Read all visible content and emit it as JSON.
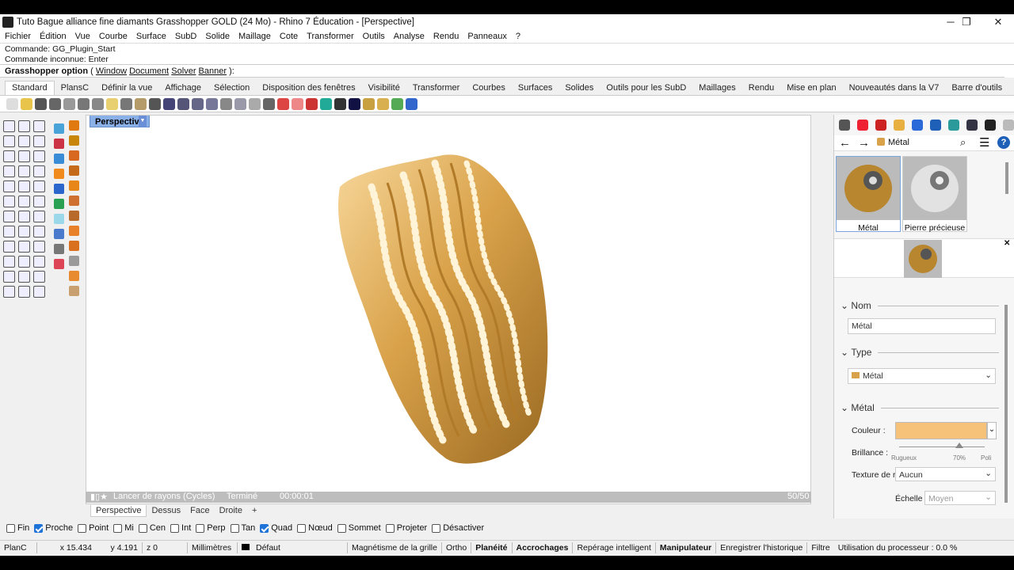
{
  "window": {
    "title": "Tuto Bague alliance fine diamants Grasshopper GOLD (24 Mo) - Rhino 7 Éducation - [Perspective]",
    "min": "─",
    "restore": "❐",
    "close": "✕"
  },
  "menu": [
    "Fichier",
    "Édition",
    "Vue",
    "Courbe",
    "Surface",
    "SubD",
    "Solide",
    "Maillage",
    "Cote",
    "Transformer",
    "Outils",
    "Analyse",
    "Rendu",
    "Panneaux",
    "?"
  ],
  "command": {
    "history": [
      "Commande: GG_Plugin_Start",
      "Commande inconnue: Enter"
    ],
    "prompt_label": "Grasshopper option",
    "options_open": " ( ",
    "options": [
      "Window",
      "Document",
      "Solver",
      "Banner"
    ],
    "options_close": " ):"
  },
  "tabs": [
    "Standard",
    "PlansC",
    "Définir la vue",
    "Affichage",
    "Sélection",
    "Disposition des fenêtres",
    "Visibilité",
    "Transformer",
    "Courbes",
    "Surfaces",
    "Solides",
    "Outils pour les SubD",
    "Maillages",
    "Rendu",
    "Mise en plan",
    "Nouveautés dans la V7",
    "Barre d'outils"
  ],
  "active_tab": "Standard",
  "viewport": {
    "title": "Perspective",
    "render": {
      "mode": "Lancer de rayons (Cycles)",
      "status": "Terminé",
      "time": "00:00:01",
      "passes": "50/50",
      "progress": 1.0
    }
  },
  "viewport_tabs": [
    "Perspective",
    "Dessus",
    "Face",
    "Droite"
  ],
  "viewport_add": "+",
  "osnaps": [
    {
      "label": "Fin",
      "on": false
    },
    {
      "label": "Proche",
      "on": true
    },
    {
      "label": "Point",
      "on": false
    },
    {
      "label": "Mi",
      "on": false
    },
    {
      "label": "Cen",
      "on": false
    },
    {
      "label": "Int",
      "on": false
    },
    {
      "label": "Perp",
      "on": false
    },
    {
      "label": "Tan",
      "on": false
    },
    {
      "label": "Quad",
      "on": true
    },
    {
      "label": "Nœud",
      "on": false
    },
    {
      "label": "Sommet",
      "on": false
    },
    {
      "label": "Projeter",
      "on": false
    },
    {
      "label": "Désactiver",
      "on": false
    }
  ],
  "status": {
    "plane": "PlanC",
    "x": "x 15.434",
    "y": "y 4.191",
    "z": "z 0",
    "units": "Millimètres",
    "layer": "Défaut",
    "snap_grid": "Magnétisme de la grille",
    "ortho": "Ortho",
    "planar": "Planéité",
    "osnap": "Accrochages",
    "smarttrack": "Repérage intelligent",
    "gumball": "Manipulateur",
    "history": "Enregistrer l'historique",
    "filter": "Filtre",
    "cpu": "Utilisation du processeur : 0.0 %"
  },
  "panel": {
    "search": "Métal",
    "materials": [
      {
        "name": "Métal"
      },
      {
        "name": "Pierre précieuse"
      }
    ],
    "sections": {
      "name": "Nom",
      "type": "Type",
      "metal": "Métal"
    },
    "name_value": "Métal",
    "type_value": "Métal",
    "color_label": "Couleur :",
    "color_value": "#f6c27a",
    "gloss_label": "Brillance :",
    "gloss_min": "Rugueux",
    "gloss_max": "Poli",
    "gloss_value": "70%",
    "gloss": 0.7,
    "texture_label": "Texture de r",
    "texture_value": "Aucun",
    "scale_label": "Échelle :",
    "scale_value": "Moyen"
  },
  "colors": {
    "gold": "#d9a24a",
    "viewport_title": "#8ab0e8",
    "accent": "#1e73d8"
  }
}
